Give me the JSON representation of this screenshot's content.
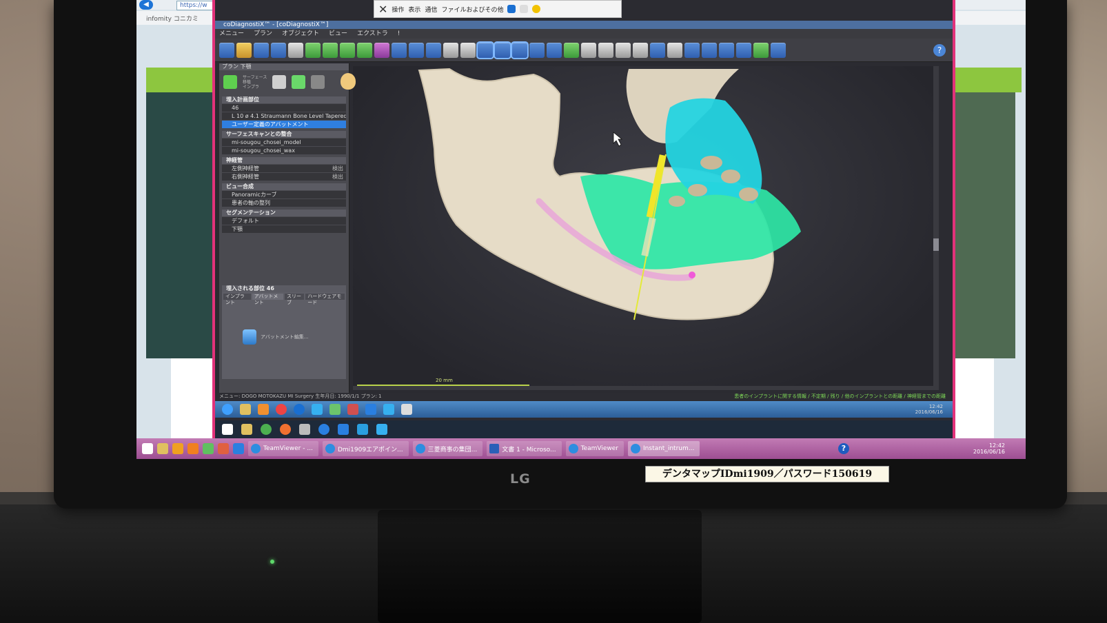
{
  "outer_browser": {
    "url": "https://w",
    "tab": "infomity コニカミ"
  },
  "teamviewer_bar": {
    "items": [
      "操作",
      "表示",
      "通信",
      "ファイルおよびその他"
    ]
  },
  "app": {
    "title": "coDiagnostiX™ - [coDiagnostiX™]",
    "menu": [
      "メニュー",
      "プラン",
      "オブジェクト",
      "ビュー",
      "エクストラ",
      "!"
    ]
  },
  "panel": {
    "header": "プラン 下顎",
    "tool_labels": [
      "サーフェース",
      "移植",
      "インプラ"
    ],
    "sections": [
      {
        "title": "埋入計画部位",
        "rows": [
          {
            "label": "46",
            "selected": false,
            "tag": ""
          },
          {
            "label": "L 10 ø 4.1   Straumann Bone Level Tapered R...",
            "selected": false,
            "tag": ""
          },
          {
            "label": "ユーザー定義のアバットメント",
            "selected": true,
            "tag": ""
          }
        ]
      },
      {
        "title": "サーフェスキャンとの整合",
        "rows": [
          {
            "label": "mi-sougou_chosei_model",
            "selected": false,
            "tag": ""
          },
          {
            "label": "mi-sougou_chosei_wax",
            "selected": false,
            "tag": ""
          }
        ]
      },
      {
        "title": "神経管",
        "rows": [
          {
            "label": "左側神経管",
            "selected": false,
            "tag": "検出"
          },
          {
            "label": "右側神経管",
            "selected": false,
            "tag": "検出"
          }
        ]
      },
      {
        "title": "ビュー合成",
        "rows": [
          {
            "label": "Panoramicカーブ",
            "selected": false,
            "tag": ""
          },
          {
            "label": "患者の軸の整列",
            "selected": false,
            "tag": ""
          }
        ]
      },
      {
        "title": "セグメンテーション",
        "rows": [
          {
            "label": "デフォルト",
            "selected": false,
            "tag": ""
          },
          {
            "label": "下顎",
            "selected": false,
            "tag": ""
          }
        ]
      }
    ],
    "sub_title": "埋入される部位 46",
    "sub_tabs": [
      "インプラント",
      "アバットメント",
      "スリーブ",
      "ハードウェアモード"
    ],
    "abutment_label": "アバットメント編集..."
  },
  "viewport": {
    "scale_label": "20 mm"
  },
  "status": {
    "left": "メニュー: DOGO MOTOKAZU MI Surgery   生年月日: 1990/1/1   プラン: 1",
    "right": "患者のインプラントに関する情報 / 不定期 / 残り / 他のインプラントとの距離 / 神経管までの距離"
  },
  "remote_clock": {
    "time": "12:42",
    "date": "2016/06/16"
  },
  "taskbar": {
    "buttons": [
      "TeamViewer - ...",
      "Dmi1909エアポイン...",
      "三菱商事の集団...",
      "文書 1 - Microso...",
      "TeamViewer",
      "Instant_intrum..."
    ],
    "time": "12:42",
    "date": "2016/06/16"
  },
  "monitor": {
    "brand": "LG",
    "sticker": "デンタマップIDmi1909／パスワード150619"
  }
}
